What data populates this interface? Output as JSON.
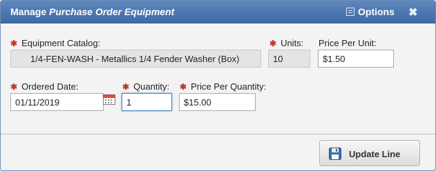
{
  "dialog": {
    "title_prefix": "Manage",
    "title_italic": "Purchase Order Equipment",
    "options_label": "Options",
    "close_glyph": "✖"
  },
  "fields": {
    "required_mark": "✱",
    "equipment_catalog": {
      "label": "Equipment Catalog:",
      "value": "1/4-FEN-WASH - Metallics 1/4 Fender Washer (Box)"
    },
    "units": {
      "label": "Units:",
      "value": "10"
    },
    "price_per_unit": {
      "label": "Price Per Unit:",
      "value": "$1.50"
    },
    "ordered_date": {
      "label": "Ordered Date:",
      "value": "01/11/2019"
    },
    "quantity": {
      "label": "Quantity:",
      "value": "1"
    },
    "price_per_quantity": {
      "label": "Price Per Quantity:",
      "value": "$15.00"
    }
  },
  "footer": {
    "update_button_label": "Update Line"
  },
  "colors": {
    "titlebar": "#4a74ad",
    "required": "#c0392b",
    "focus": "#4a86c5"
  },
  "icons": {
    "options": "list-icon",
    "close": "close-icon",
    "calendar": "calendar-icon",
    "save": "floppy-disk-icon"
  }
}
